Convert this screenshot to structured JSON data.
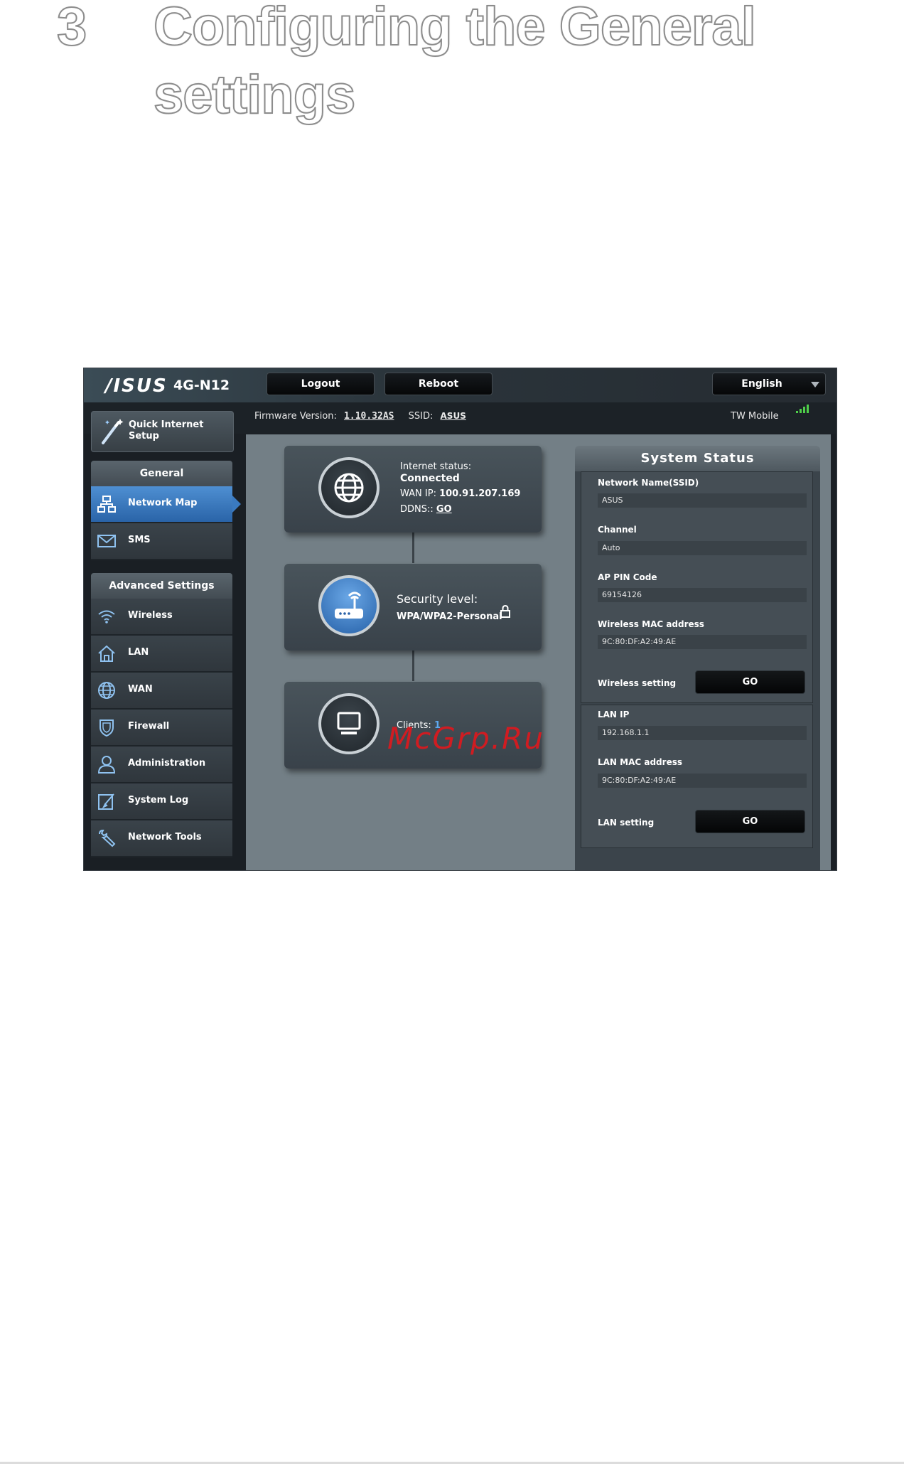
{
  "heading": {
    "number": "3",
    "title_line1": "Configuring the General",
    "title_line2": "settings"
  },
  "router": {
    "brand": "/ISUS",
    "model": "4G-N12",
    "topbar": {
      "logout": "Logout",
      "reboot": "Reboot",
      "language": "English"
    },
    "infobar": {
      "firmware_label": "Firmware Version:",
      "firmware_value": "1.10.32AS",
      "ssid_label": "SSID:",
      "ssid_value": "ASUS",
      "carrier": "TW Mobile"
    },
    "sidebar": {
      "quick_setup": "Quick Internet Setup",
      "general_header": "General",
      "general_items": [
        {
          "label": "Network Map",
          "icon": "network-map-icon",
          "active": true
        },
        {
          "label": "SMS",
          "icon": "envelope-icon",
          "active": false
        }
      ],
      "advanced_header": "Advanced Settings",
      "advanced_items": [
        {
          "label": "Wireless",
          "icon": "wifi-icon"
        },
        {
          "label": "LAN",
          "icon": "home-icon"
        },
        {
          "label": "WAN",
          "icon": "globe-icon"
        },
        {
          "label": "Firewall",
          "icon": "shield-icon"
        },
        {
          "label": "Administration",
          "icon": "user-icon"
        },
        {
          "label": "System Log",
          "icon": "log-icon"
        },
        {
          "label": "Network Tools",
          "icon": "wrench-icon"
        }
      ]
    },
    "map": {
      "internet_label": "Internet status:",
      "internet_status": "Connected",
      "wan_ip_label": "WAN IP:",
      "wan_ip_value": "100.91.207.169",
      "ddns_label": "DDNS::",
      "ddns_link": "GO",
      "security_label": "Security level:",
      "security_value": "WPA/WPA2-Personal",
      "clients_label": "Clients:",
      "clients_value": "1"
    },
    "system_status": {
      "title": "System Status",
      "network_name_label": "Network Name(SSID)",
      "network_name_value": "ASUS",
      "channel_label": "Channel",
      "channel_value": "Auto",
      "ap_pin_label": "AP PIN Code",
      "ap_pin_value": "69154126",
      "wireless_mac_label": "Wireless MAC address",
      "wireless_mac_value": "9C:80:DF:A2:49:AE",
      "wireless_setting_label": "Wireless setting",
      "wireless_go": "GO",
      "lan_ip_label": "LAN IP",
      "lan_ip_value": "192.168.1.1",
      "lan_mac_label": "LAN MAC address",
      "lan_mac_value": "9C:80:DF:A2:49:AE",
      "lan_setting_label": "LAN setting",
      "lan_go": "GO"
    }
  },
  "watermark": "McGrp.Ru"
}
